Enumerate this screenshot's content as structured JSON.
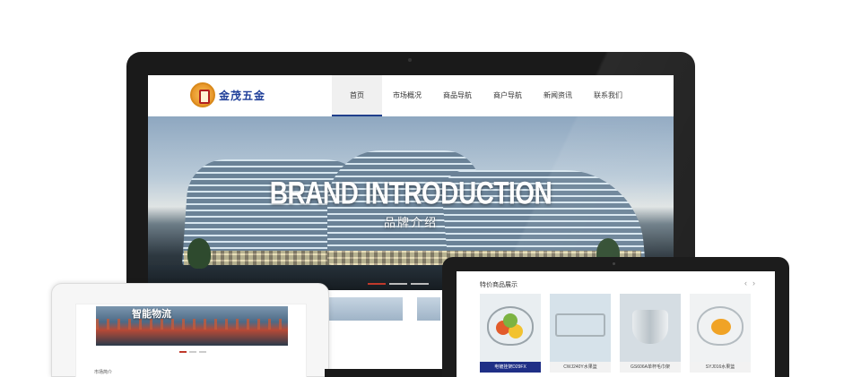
{
  "desktop": {
    "logo_text": "金茂五金",
    "nav": [
      {
        "label": "首页",
        "active": true
      },
      {
        "label": "市场概况"
      },
      {
        "label": "商品导航"
      },
      {
        "label": "商户导航"
      },
      {
        "label": "新闻资讯"
      },
      {
        "label": "联系我们"
      }
    ],
    "hero": {
      "title": "BRAND INTRODUCTION",
      "subtitle": "品牌介绍"
    }
  },
  "tablet": {
    "section_title": "特价商品展示",
    "prev_arrow": "‹",
    "next_arrow": "›",
    "products": [
      {
        "caption": "电镀挂架D29FX",
        "active": true
      },
      {
        "caption": "CWJ240Y水果篮"
      },
      {
        "caption": "GS606A单杯毛巾架"
      },
      {
        "caption": "SYJ016水果篮"
      }
    ]
  },
  "tablet_left": {
    "banner_title": "智能物流",
    "section_label": "市场简介"
  },
  "colors": {
    "brand_blue": "#1f3f99",
    "active_nav_underline": "#203f8c",
    "slider_active": "#c0392b",
    "product_active": "#1f2f86"
  }
}
